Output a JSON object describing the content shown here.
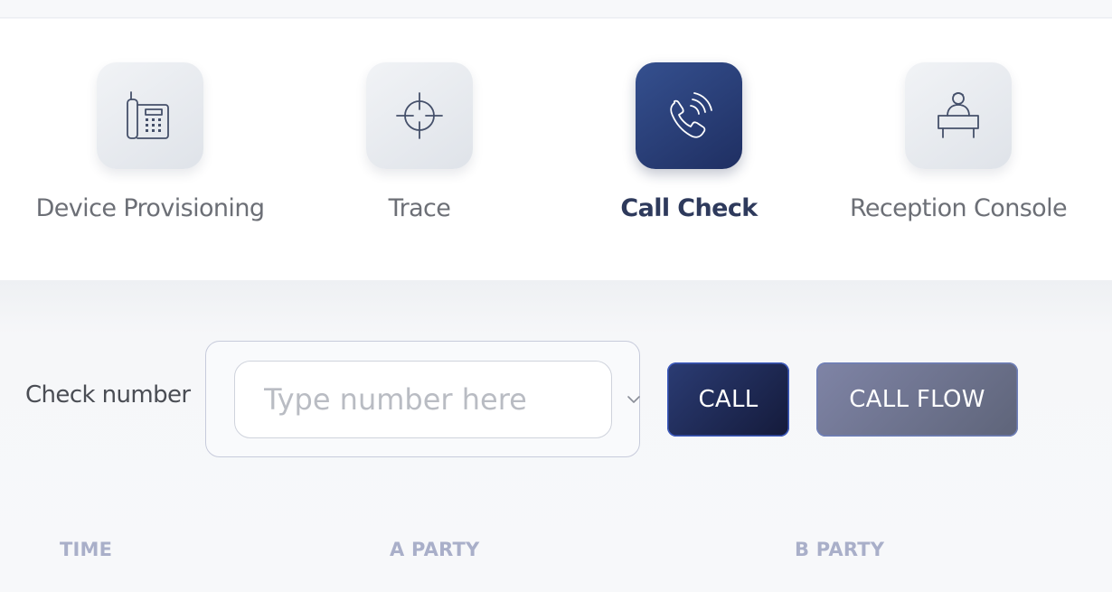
{
  "tools": [
    {
      "label": "Device Provisioning",
      "icon": "desk-phone-icon",
      "active": false
    },
    {
      "label": "Trace",
      "icon": "crosshair-icon",
      "active": false
    },
    {
      "label": "Call Check",
      "icon": "phone-ringing-icon",
      "active": true
    },
    {
      "label": "Reception Console",
      "icon": "receptionist-desk-icon",
      "active": false
    }
  ],
  "check": {
    "label": "Check number",
    "placeholder": "Type number here",
    "value": ""
  },
  "buttons": {
    "call": "CALL",
    "call_flow": "CALL FLOW"
  },
  "table": {
    "columns": [
      "TIME",
      "A PARTY",
      "B PARTY"
    ]
  },
  "colors": {
    "accent": "#2b3c74",
    "active_tile": "#35508f",
    "column_header": "#a9afc9"
  }
}
